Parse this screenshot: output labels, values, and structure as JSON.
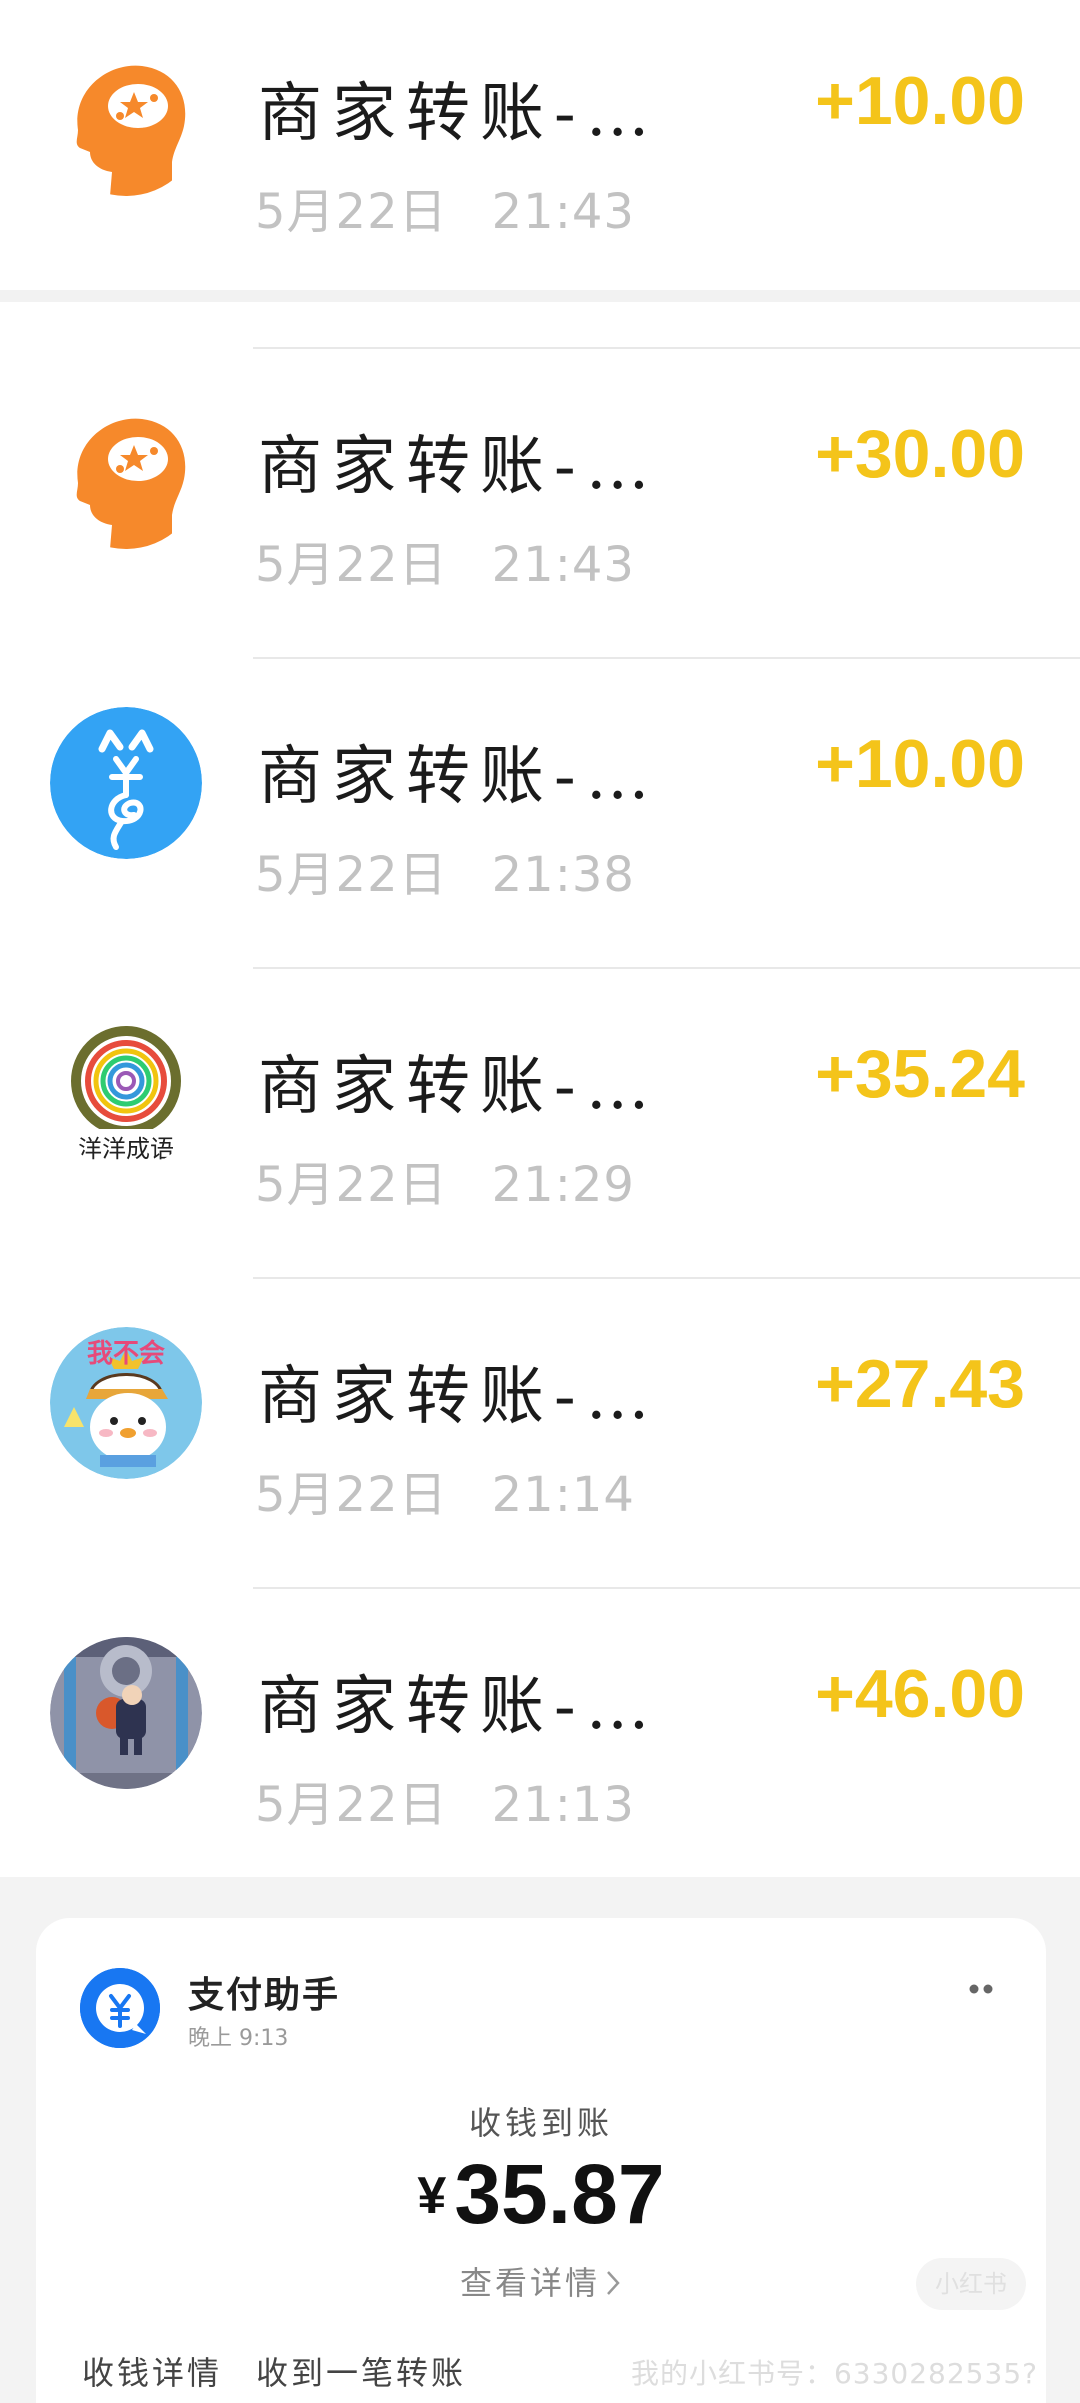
{
  "transactions": [
    {
      "title": "商家转账-…",
      "date": "5月22日",
      "time": "21:43",
      "amount": "+10.00",
      "avatar_icon": "orange-head-star-icon"
    },
    {
      "title": "商家转账-…",
      "date": "5月22日",
      "time": "21:43",
      "amount": "+30.00",
      "avatar_icon": "orange-head-star-icon"
    },
    {
      "title": "商家转账-…",
      "date": "5月22日",
      "time": "21:38",
      "amount": "+10.00",
      "avatar_icon": "blue-cat-yuan-icon"
    },
    {
      "title": "商家转账-…",
      "date": "5月22日",
      "time": "21:29",
      "amount": "+35.24",
      "avatar_icon": "rainbow-ring-logo-icon",
      "avatar_text": "洋洋成语"
    },
    {
      "title": "商家转账-…",
      "date": "5月22日",
      "time": "21:14",
      "amount": "+27.43",
      "avatar_icon": "cartoon-chick-icon",
      "avatar_text": "我不会"
    },
    {
      "title": "商家转账-…",
      "date": "5月22日",
      "time": "21:13",
      "amount": "+46.00",
      "avatar_icon": "game-character-icon"
    }
  ],
  "notification": {
    "sender": "支付助手",
    "time": "晚上 9:13",
    "label": "收钱到账",
    "currency": "¥",
    "amount": "35.87",
    "view_details": "查看详情",
    "footer_title": "收钱详情",
    "footer_value": "收到一笔转账",
    "watermark": "我的小红书号：6330282535?",
    "watermark_badge": "小红书"
  },
  "colors": {
    "amount": "#f4c41a",
    "orange_avatar": "#f6892b",
    "blue_avatar": "#33a3f4",
    "pay_blue": "#1877f2"
  }
}
